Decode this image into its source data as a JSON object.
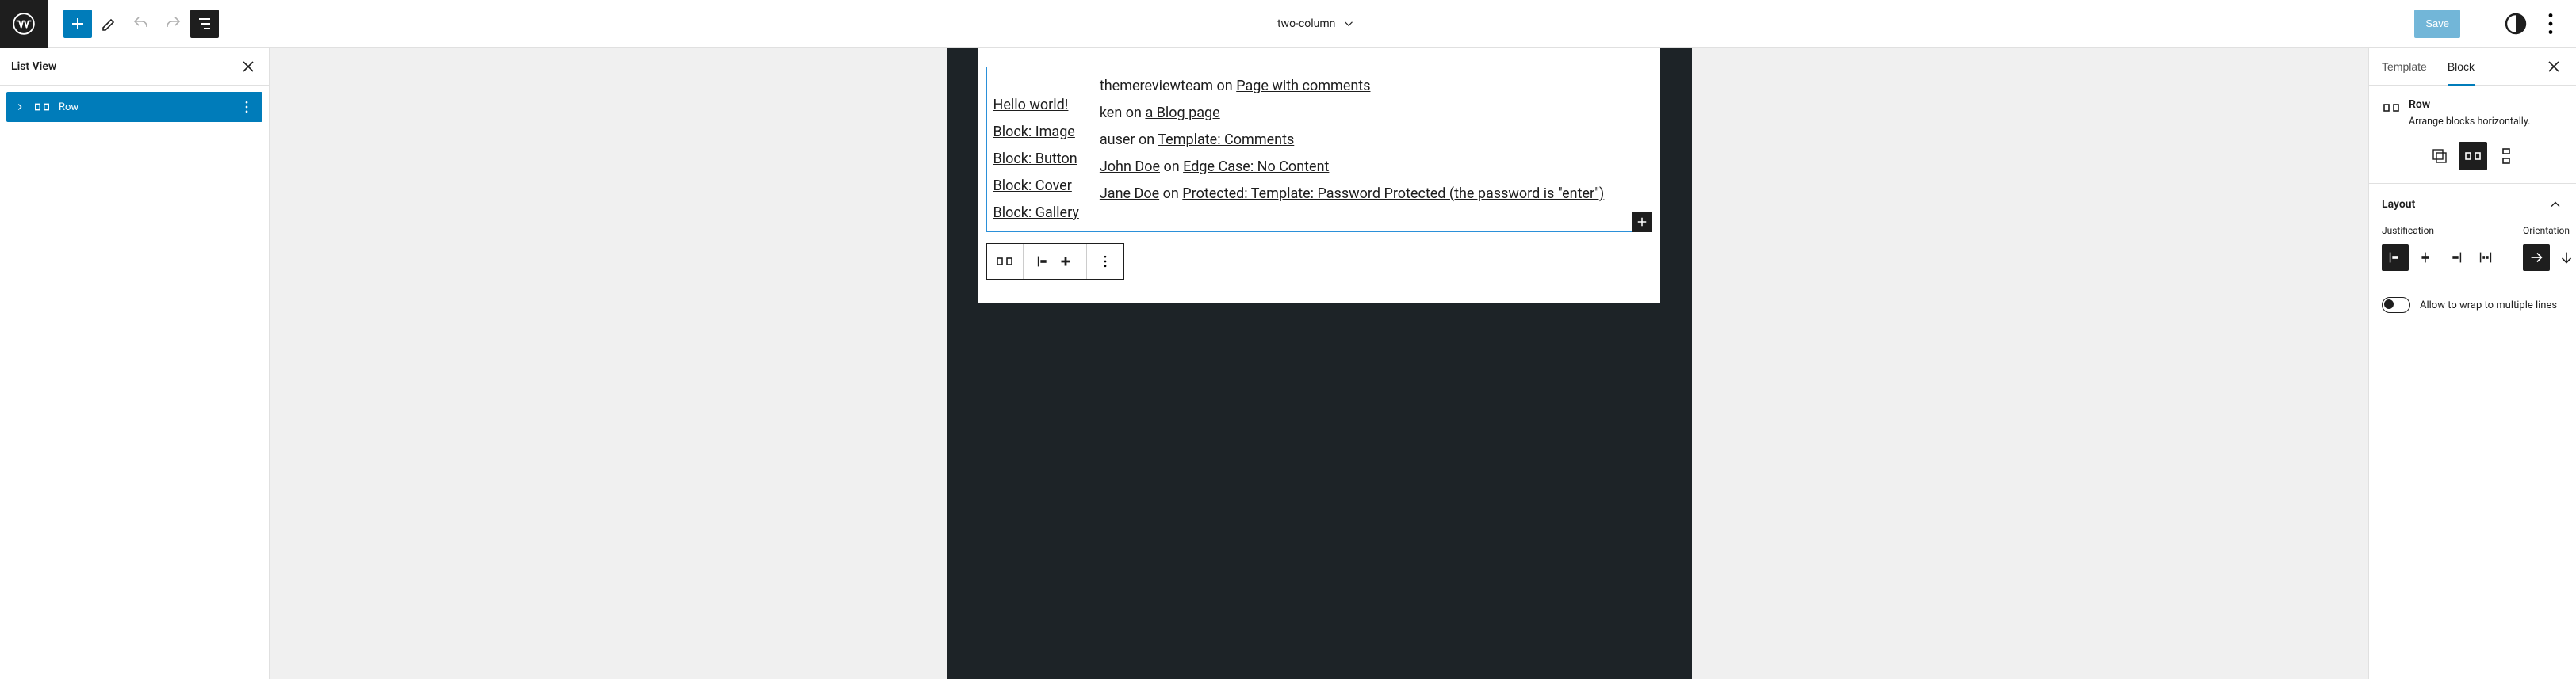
{
  "header": {
    "template_title": "two-column",
    "save_label": "Save"
  },
  "listview": {
    "title": "List View",
    "rows": [
      {
        "label": "Row"
      }
    ]
  },
  "canvas": {
    "left_column": [
      "Hello world!",
      "Block: Image",
      "Block: Button",
      "Block: Cover",
      "Block: Gallery"
    ],
    "comments": [
      {
        "author": "themereviewteam",
        "on": " on ",
        "post": "Page with comments",
        "author_linked": false
      },
      {
        "author": "ken",
        "on": " on ",
        "post": "a Blog page",
        "author_linked": false
      },
      {
        "author": "auser",
        "on": " on ",
        "post": "Template: Comments",
        "author_linked": false
      },
      {
        "author": "John Doe",
        "on": " on ",
        "post": "Edge Case: No Content",
        "author_linked": true
      },
      {
        "author": "Jane Doe",
        "on": " on ",
        "post": "Protected: Template: Password Protected (the password is \"enter\")",
        "author_linked": true
      }
    ]
  },
  "sidebar": {
    "tabs": {
      "template": "Template",
      "block": "Block"
    },
    "block": {
      "name": "Row",
      "description": "Arrange blocks horizontally."
    },
    "layout": {
      "title": "Layout",
      "justification_label": "Justification",
      "orientation_label": "Orientation",
      "wrap_label": "Allow to wrap to multiple lines"
    }
  },
  "colors": {
    "accent": "#007cba",
    "dark": "#1e1e1e"
  }
}
